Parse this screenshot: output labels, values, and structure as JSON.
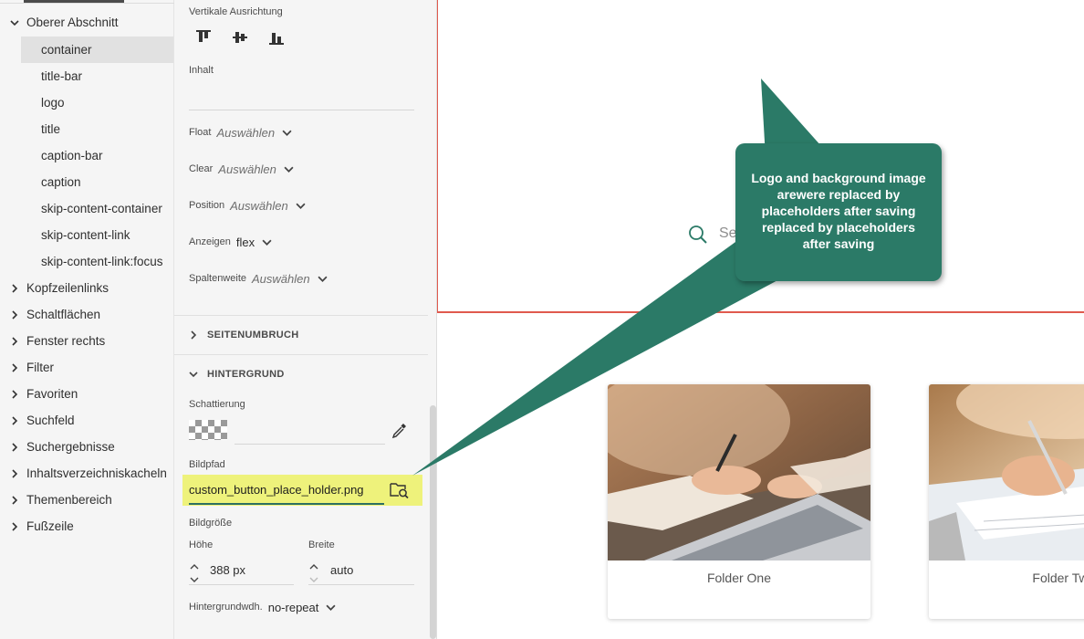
{
  "tree": {
    "expanded_section": "Oberer Abschnitt",
    "children": [
      "container",
      "title-bar",
      "logo",
      "title",
      "caption-bar",
      "caption",
      "skip-content-container",
      "skip-content-link",
      "skip-content-link:focus"
    ],
    "selected_child": "container",
    "sections": [
      "Kopfzeilenlinks",
      "Schaltflächen",
      "Fenster rechts",
      "Filter",
      "Favoriten",
      "Suchfeld",
      "Suchergebnisse",
      "Inhaltsverzeichniskacheln",
      "Themenbereich",
      "Fußzeile"
    ]
  },
  "props": {
    "vertical_alignment_label": "Vertikale Ausrichtung",
    "align_icons": [
      "align-top-icon",
      "align-middle-icon",
      "align-bottom-icon"
    ],
    "content_label": "Inhalt",
    "content_value": "",
    "float": {
      "label": "Float",
      "value": "Auswählen"
    },
    "clear": {
      "label": "Clear",
      "value": "Auswählen"
    },
    "position": {
      "label": "Position",
      "value": "Auswählen"
    },
    "display": {
      "label": "Anzeigen",
      "value": "flex"
    },
    "column_width": {
      "label": "Spaltenweite",
      "value": "Auswählen"
    },
    "page_break_section": "SEITENUMBRUCH",
    "background_section": "HINTERGRUND",
    "shading_label": "Schattierung",
    "image_path_label": "Bildpfad",
    "image_path_value": "custom_button_place_holder.png",
    "image_size_label": "Bildgröße",
    "height": {
      "label": "Höhe",
      "value": "388 px"
    },
    "width": {
      "label": "Breite",
      "value": "auto"
    },
    "bg_repeat": {
      "label": "Hintergrundwdh.",
      "value": "no-repeat"
    }
  },
  "preview": {
    "search_placeholder": "Sea",
    "cards": [
      {
        "title": "Folder One"
      },
      {
        "title": "Folder Tw"
      }
    ]
  },
  "callout": {
    "text": "Logo and background image arewere replaced by placeholders after saving replaced by placeholders after saving"
  },
  "colors": {
    "accent_green": "#2b7a67",
    "highlight_yellow": "#eef27b",
    "hero_border_red": "#e05a4e"
  }
}
